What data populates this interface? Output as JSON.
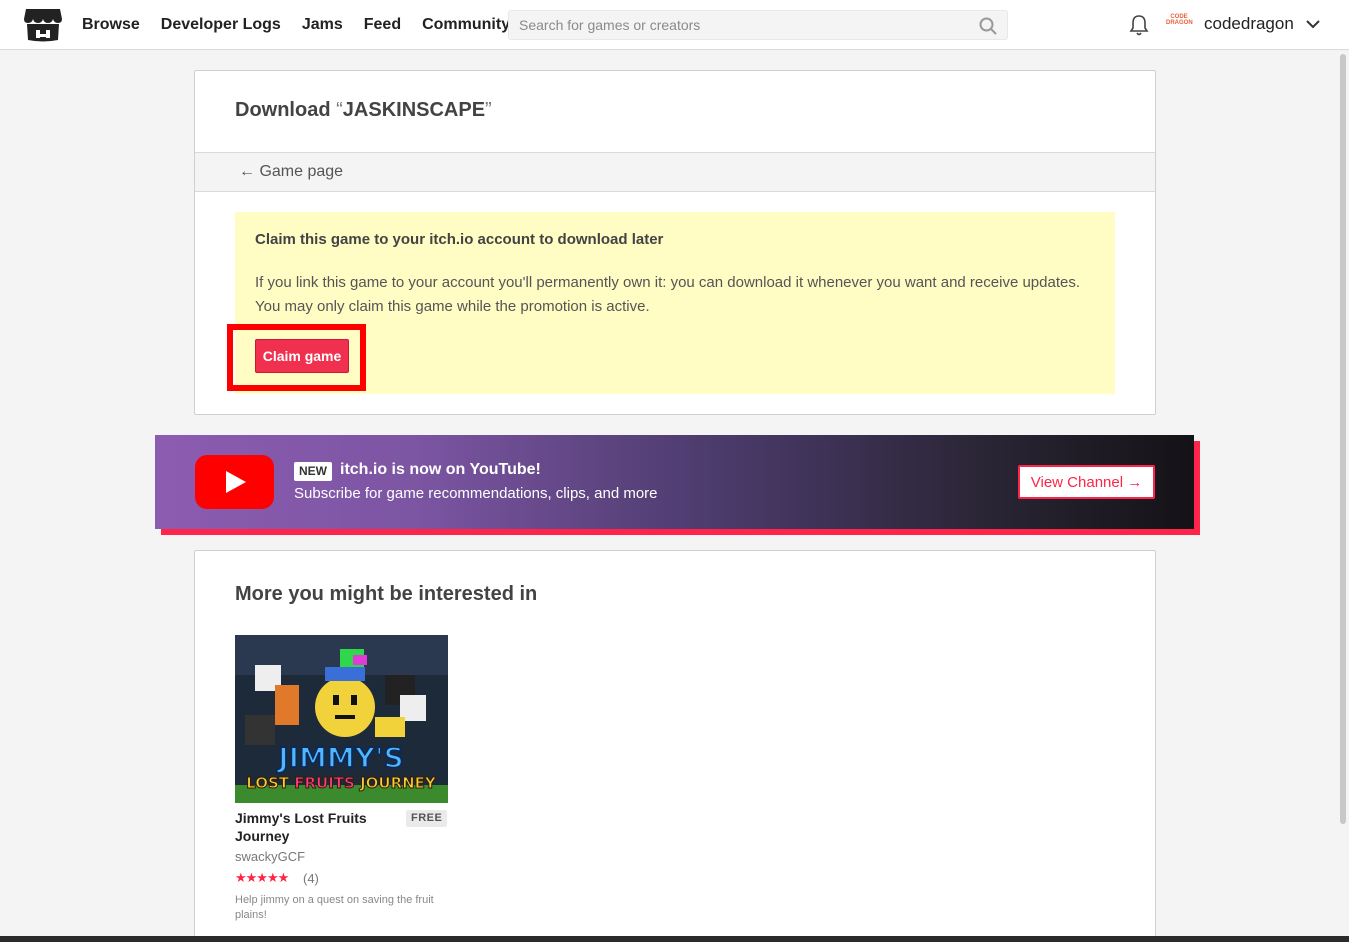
{
  "header": {
    "nav": [
      "Browse",
      "Developer Logs",
      "Jams",
      "Feed",
      "Community"
    ],
    "search_placeholder": "Search for games or creators",
    "avatar_text": "CODE DRAGON",
    "username": "codedragon"
  },
  "download": {
    "title_prefix": "Download ",
    "open_quote": "“",
    "game_name": "JASKINSCAPE",
    "close_quote": "”",
    "back_arrow": "←",
    "back_label": "Game page",
    "claim_heading": "Claim this game to your itch.io account to download later",
    "claim_text": "If you link this game to your account you'll permanently own it: you can download it whenever you want and receive updates. You may only claim this game while the promotion is active.",
    "claim_button": "Claim game"
  },
  "banner": {
    "badge": "NEW",
    "title": "itch.io is now on YouTube!",
    "subtitle": "Subscribe for game recommendations, clips, and more",
    "button": "View Channel →"
  },
  "recommendations": {
    "title": "More you might be interested in",
    "games": [
      {
        "title": "Jimmy's Lost Fruits Journey",
        "price": "FREE",
        "author": "swackyGCF",
        "rating": 5,
        "stars": "★★★★★",
        "rating_count": "(4)",
        "description": "Help jimmy on a quest on saving the fruit plains!",
        "thumb_line1": "JIMMY'S",
        "thumb_line2a": "LOST ",
        "thumb_line2b": "FRUITS",
        "thumb_line2c": " JOURNEY"
      }
    ]
  },
  "colors": {
    "accent": "#ff2449",
    "claim_bg": "#fffcc4",
    "highlight": "#ff0000"
  }
}
